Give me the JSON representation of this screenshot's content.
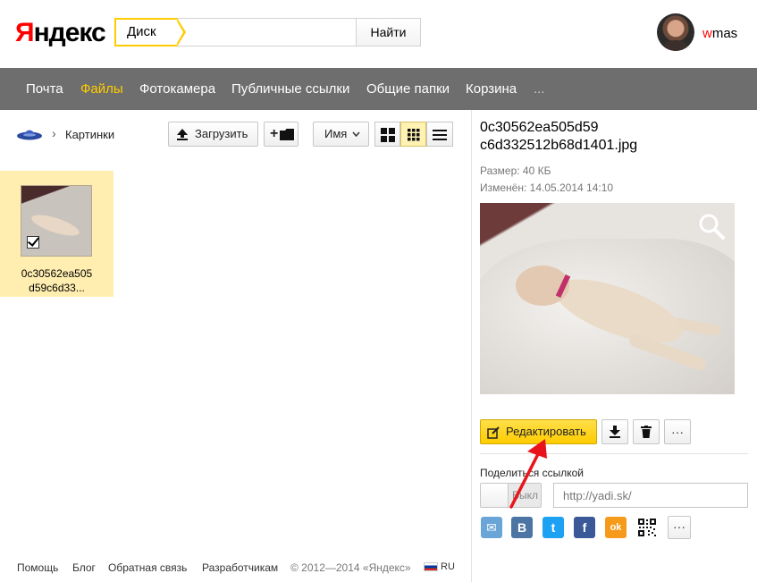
{
  "header": {
    "logo_first": "Я",
    "logo_rest": "ндекс",
    "search_tag": "Диск",
    "search_value": "",
    "search_button": "Найти",
    "username_first": "w",
    "username_rest": "mas"
  },
  "nav": {
    "items": [
      "Почта",
      "Файлы",
      "Фотокамера",
      "Публичные ссылки",
      "Общие папки",
      "Корзина",
      "..."
    ]
  },
  "toolbar": {
    "breadcrumb_sep": "›",
    "breadcrumb": "Картинки",
    "upload": "Загрузить",
    "new_folder": "+",
    "sort": "Имя"
  },
  "file": {
    "name_line1": "0c30562ea505",
    "name_line2": "d59c6d33..."
  },
  "details": {
    "title_line1": "0c30562ea505d59",
    "title_line2": "c6d332512b68d1401.jpg",
    "size": "Размер: 40 КБ",
    "modified": "Изменён: 14.05.2014 14:10",
    "edit_button": "Редактировать",
    "more": "···",
    "share_label": "Поделиться ссылкой",
    "toggle_label": "Выкл",
    "link_placeholder": "http://yadi.sk/"
  },
  "social": [
    {
      "name": "mail",
      "glyph": "✉",
      "color": "#6aa5d8"
    },
    {
      "name": "vk",
      "glyph": "В",
      "color": "#4c75a3"
    },
    {
      "name": "twitter",
      "glyph": "t",
      "color": "#1da1f2"
    },
    {
      "name": "facebook",
      "glyph": "f",
      "color": "#3b5998"
    },
    {
      "name": "odnoklassniki",
      "glyph": "ok",
      "color": "#f59a1a"
    }
  ],
  "footer": {
    "help": "Помощь",
    "blog": "Блог",
    "feedback": "Обратная связь",
    "developers": "Разработчикам",
    "copyright": "© 2012—2014 «Яндекс»",
    "lang": "RU"
  }
}
